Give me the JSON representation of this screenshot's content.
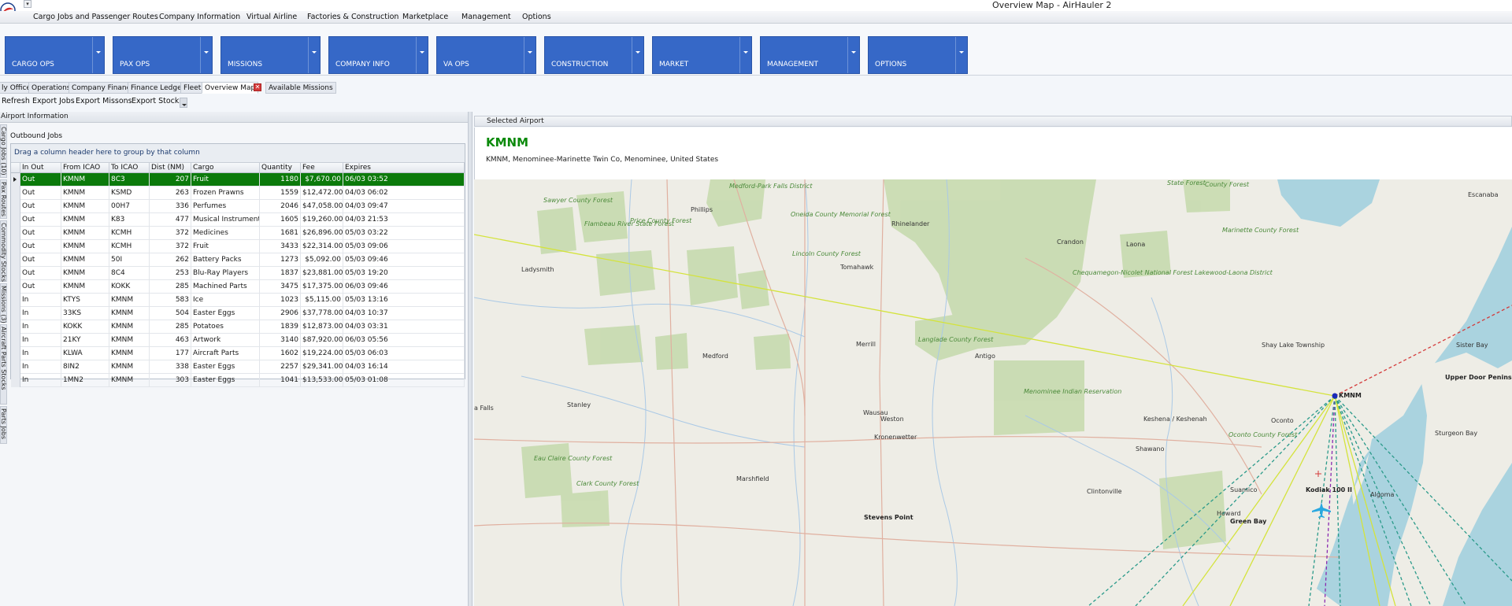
{
  "window": {
    "title": "Overview Map - AirHauler 2",
    "quick_access": "▾"
  },
  "menu": [
    "Cargo Jobs and Passenger Routes",
    "Company Information",
    "Virtual Airline",
    "Factories & Construction",
    "Marketplace",
    "Management",
    "Options"
  ],
  "ribbon": [
    "CARGO OPS",
    "PAX OPS",
    "MISSIONS",
    "COMPANY INFO",
    "VA OPS",
    "CONSTRUCTION",
    "MARKET",
    "MANAGEMENT",
    "OPTIONS"
  ],
  "doc_tabs": [
    "ly Office",
    "Operations",
    "Company Finance",
    "Finance Ledger",
    "Fleet",
    "Overview Map",
    "Available Missions"
  ],
  "tab_close": "✕",
  "toolbar": [
    "Refresh",
    "Export Jobs",
    "Export Missons",
    "Export Stocks"
  ],
  "left": {
    "panel_title": "Airport Information",
    "vtabs": [
      "Cargo Jobs (10)",
      "Pax Routes",
      "Commodity Stocks",
      "Missions (3)",
      "Aircraft Parts Stocks",
      "Parts Jobs"
    ],
    "subpanel_title": "Outbound Jobs",
    "group_hint": "Drag a column header here to group by that column",
    "columns": [
      "In Out",
      "From ICAO",
      "To ICAO",
      "Dist (NM)",
      "Cargo",
      "Quantity",
      "Fee",
      "Expires"
    ],
    "rows": [
      [
        "Out",
        "KMNM",
        "8C3",
        "207",
        "Fruit",
        "1180",
        "$7,670.00",
        "06/03 03:52"
      ],
      [
        "Out",
        "KMNM",
        "KSMD",
        "263",
        "Frozen Prawns",
        "1559",
        "$12,472.00",
        "04/03 06:02"
      ],
      [
        "Out",
        "KMNM",
        "00H7",
        "336",
        "Perfumes",
        "2046",
        "$47,058.00",
        "04/03 09:47"
      ],
      [
        "Out",
        "KMNM",
        "K83",
        "477",
        "Musical Instruments",
        "1605",
        "$19,260.00",
        "04/03 21:53"
      ],
      [
        "Out",
        "KMNM",
        "KCMH",
        "372",
        "Medicines",
        "1681",
        "$26,896.00",
        "05/03 03:22"
      ],
      [
        "Out",
        "KMNM",
        "KCMH",
        "372",
        "Fruit",
        "3433",
        "$22,314.00",
        "05/03 09:06"
      ],
      [
        "Out",
        "KMNM",
        "50I",
        "262",
        "Battery Packs",
        "1273",
        "$5,092.00",
        "05/03 09:46"
      ],
      [
        "Out",
        "KMNM",
        "8C4",
        "253",
        "Blu-Ray Players",
        "1837",
        "$23,881.00",
        "05/03 19:20"
      ],
      [
        "Out",
        "KMNM",
        "KOKK",
        "285",
        "Machined Parts",
        "3475",
        "$17,375.00",
        "06/03 09:46"
      ],
      [
        "In",
        "KTYS",
        "KMNM",
        "583",
        "Ice",
        "1023",
        "$5,115.00",
        "05/03 13:16"
      ],
      [
        "In",
        "33KS",
        "KMNM",
        "504",
        "Easter Eggs",
        "2906",
        "$37,778.00",
        "04/03 10:37"
      ],
      [
        "In",
        "KOKK",
        "KMNM",
        "285",
        "Potatoes",
        "1839",
        "$12,873.00",
        "04/03 03:31"
      ],
      [
        "In",
        "21KY",
        "KMNM",
        "463",
        "Artwork",
        "3140",
        "$87,920.00",
        "06/03 05:56"
      ],
      [
        "In",
        "KLWA",
        "KMNM",
        "177",
        "Aircraft Parts",
        "1602",
        "$19,224.00",
        "05/03 06:03"
      ],
      [
        "In",
        "8IN2",
        "KMNM",
        "338",
        "Easter Eggs",
        "2257",
        "$29,341.00",
        "04/03 16:14"
      ],
      [
        "In",
        "1MN2",
        "KMNM",
        "303",
        "Easter Eggs",
        "1041",
        "$13,533.00",
        "05/03 01:08"
      ]
    ]
  },
  "right": {
    "panel_title": "Selected Airport",
    "airport_code": "KMNM",
    "airport_desc": "KMNM, Menominee-Marinette Twin Co, Menominee, United States"
  },
  "map": {
    "airport_marker": "KMNM",
    "aircraft_label": "Kodiak 100 II",
    "places": [
      "Medford-Park Falls District",
      "Sawyer County Forest",
      "Flambeau River State Forest",
      "Price County Forest",
      "Oneida County Memorial Forest",
      "Phillips",
      "Rhinelander",
      "Crandon",
      "Laona",
      "Marinette County Forest",
      "Escanaba",
      "Ladysmith",
      "Lincoln County Forest",
      "Tomahawk",
      "Chequamegon-Nicolet National Forest Lakewood-Laona District",
      "Shay Lake Township",
      "Sister Bay",
      "Upper Door Peninsula",
      "Medford",
      "Merrill",
      "Langlade County Forest",
      "Antigo",
      "Menominee Indian Reservation",
      "Stanley",
      "Wausau",
      "Weston",
      "Keshena / Keshenah",
      "Oconto",
      "Sturgeon Bay",
      "Kronenwetter",
      "Shawano",
      "Oconto County Forest",
      "Eau Claire County Forest",
      "Marshfield",
      "Clark County Forest",
      "Clintonville",
      "Suamico",
      "Algoma",
      "Howard",
      "Green Bay",
      "Stevens Point",
      "a Falls",
      "County Forest",
      "State Forest"
    ]
  },
  "colors": {
    "ribbon": "#3668c7",
    "selected_row": "#0b7a0b",
    "airport_code": "#0c8a0c"
  }
}
